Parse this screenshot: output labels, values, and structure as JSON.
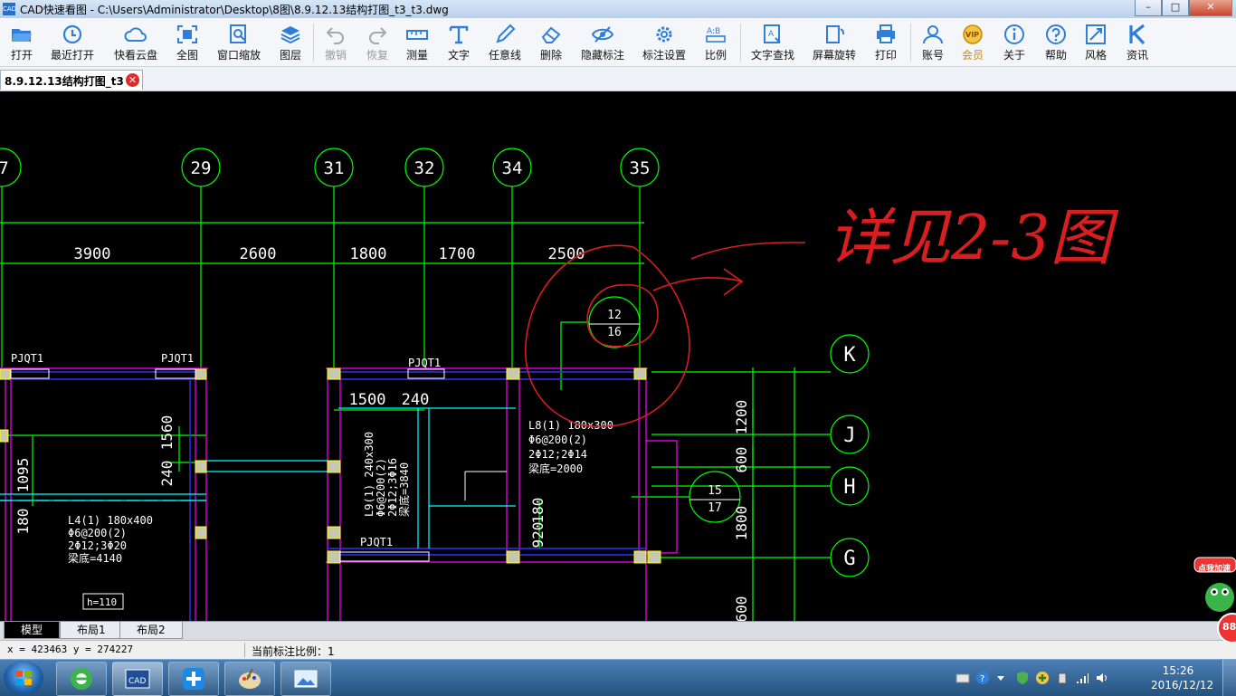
{
  "window": {
    "app_icon_text": "CAD",
    "title": "CAD快速看图 - C:\\Users\\Administrator\\Desktop\\8图\\8.9.12.13结构打图_t3_t3.dwg",
    "minimize": "–",
    "maximize": "□",
    "close": "✕"
  },
  "toolbar": {
    "items": [
      {
        "label": "打开",
        "icon": "folder-open-icon"
      },
      {
        "label": "最近打开",
        "icon": "recent-clock-icon"
      },
      {
        "label": "快看云盘",
        "icon": "cloud-icon"
      },
      {
        "label": "全图",
        "icon": "fullview-icon"
      },
      {
        "label": "窗口缩放",
        "icon": "window-zoom-icon"
      },
      {
        "label": "图层",
        "icon": "layers-icon"
      },
      {
        "label": "撤销",
        "icon": "undo-icon"
      },
      {
        "label": "恢复",
        "icon": "redo-icon"
      },
      {
        "label": "测量",
        "icon": "measure-icon"
      },
      {
        "label": "文字",
        "icon": "text-icon"
      },
      {
        "label": "任意线",
        "icon": "pen-icon"
      },
      {
        "label": "删除",
        "icon": "eraser-icon"
      },
      {
        "label": "隐藏标注",
        "icon": "hide-eye-icon"
      },
      {
        "label": "标注设置",
        "icon": "settings-gear-icon"
      },
      {
        "label": "比例",
        "icon": "scale-ab-icon"
      },
      {
        "label": "文字查找",
        "icon": "text-search-icon"
      },
      {
        "label": "屏幕旋转",
        "icon": "rotate-screen-icon"
      },
      {
        "label": "打印",
        "icon": "printer-icon"
      },
      {
        "label": "账号",
        "icon": "user-icon"
      },
      {
        "label": "会员",
        "icon": "vip-badge-icon"
      },
      {
        "label": "关于",
        "icon": "info-icon"
      },
      {
        "label": "帮助",
        "icon": "help-icon"
      },
      {
        "label": "风格",
        "icon": "style-icon"
      },
      {
        "label": "资讯",
        "icon": "news-k-icon"
      }
    ]
  },
  "doc_tab": {
    "label": "8.9.12.13结构打图_t3",
    "close": "✕"
  },
  "drawing": {
    "axis_top": [
      "7",
      "29",
      "31",
      "32",
      "34",
      "35"
    ],
    "axis_right": [
      "K",
      "J",
      "H",
      "G"
    ],
    "dimensions_top": [
      "3900",
      "2600",
      "1800",
      "1700",
      "2500"
    ],
    "dims_inner": [
      "1500",
      "240"
    ],
    "dims_vertical": [
      "1560",
      "240",
      "1095",
      "180",
      "920",
      "180",
      "1200",
      "600",
      "1800",
      "600"
    ],
    "beam_tags": [
      "PJQT1",
      "PJQT1",
      "PJQT1",
      "PJQT1"
    ],
    "callout_a": [
      "12",
      "16"
    ],
    "callout_b": [
      "15",
      "17"
    ],
    "beam_L8": [
      "L8(1) 180x300",
      "Φ6@200(2)",
      "2Φ12;2Φ14",
      "梁底=2000"
    ],
    "beam_L4": [
      "L4(1) 180x400",
      "Φ6@200(2)",
      "2Φ12;3Φ20",
      "梁底=4140"
    ],
    "beam_L9": [
      "L9(1) 240x300",
      "Φ6@200(2)",
      "2Φ12;3Φ16",
      "梁底=3840"
    ],
    "slab_h": "h=110",
    "markup_text": "详见2-3图",
    "colors": {
      "axis": "#00ff00",
      "wall": "#ff00ff",
      "beam": "#4040ff",
      "cyan": "#00ffff",
      "markup": "#d81e1e"
    }
  },
  "layout_tabs": [
    "模型",
    "布局1",
    "布局2"
  ],
  "status": {
    "coords": "x = 423463  y = 274227",
    "scale": "当前标注比例：1"
  },
  "promo": {
    "label": "点我加速",
    "number": "88"
  },
  "taskbar": {
    "apps": [
      "ie-icon",
      "cad-app-icon",
      "pinwheel-icon",
      "paint-icon",
      "image-viewer-icon"
    ],
    "time": "15:26",
    "date": "2016/12/12"
  }
}
